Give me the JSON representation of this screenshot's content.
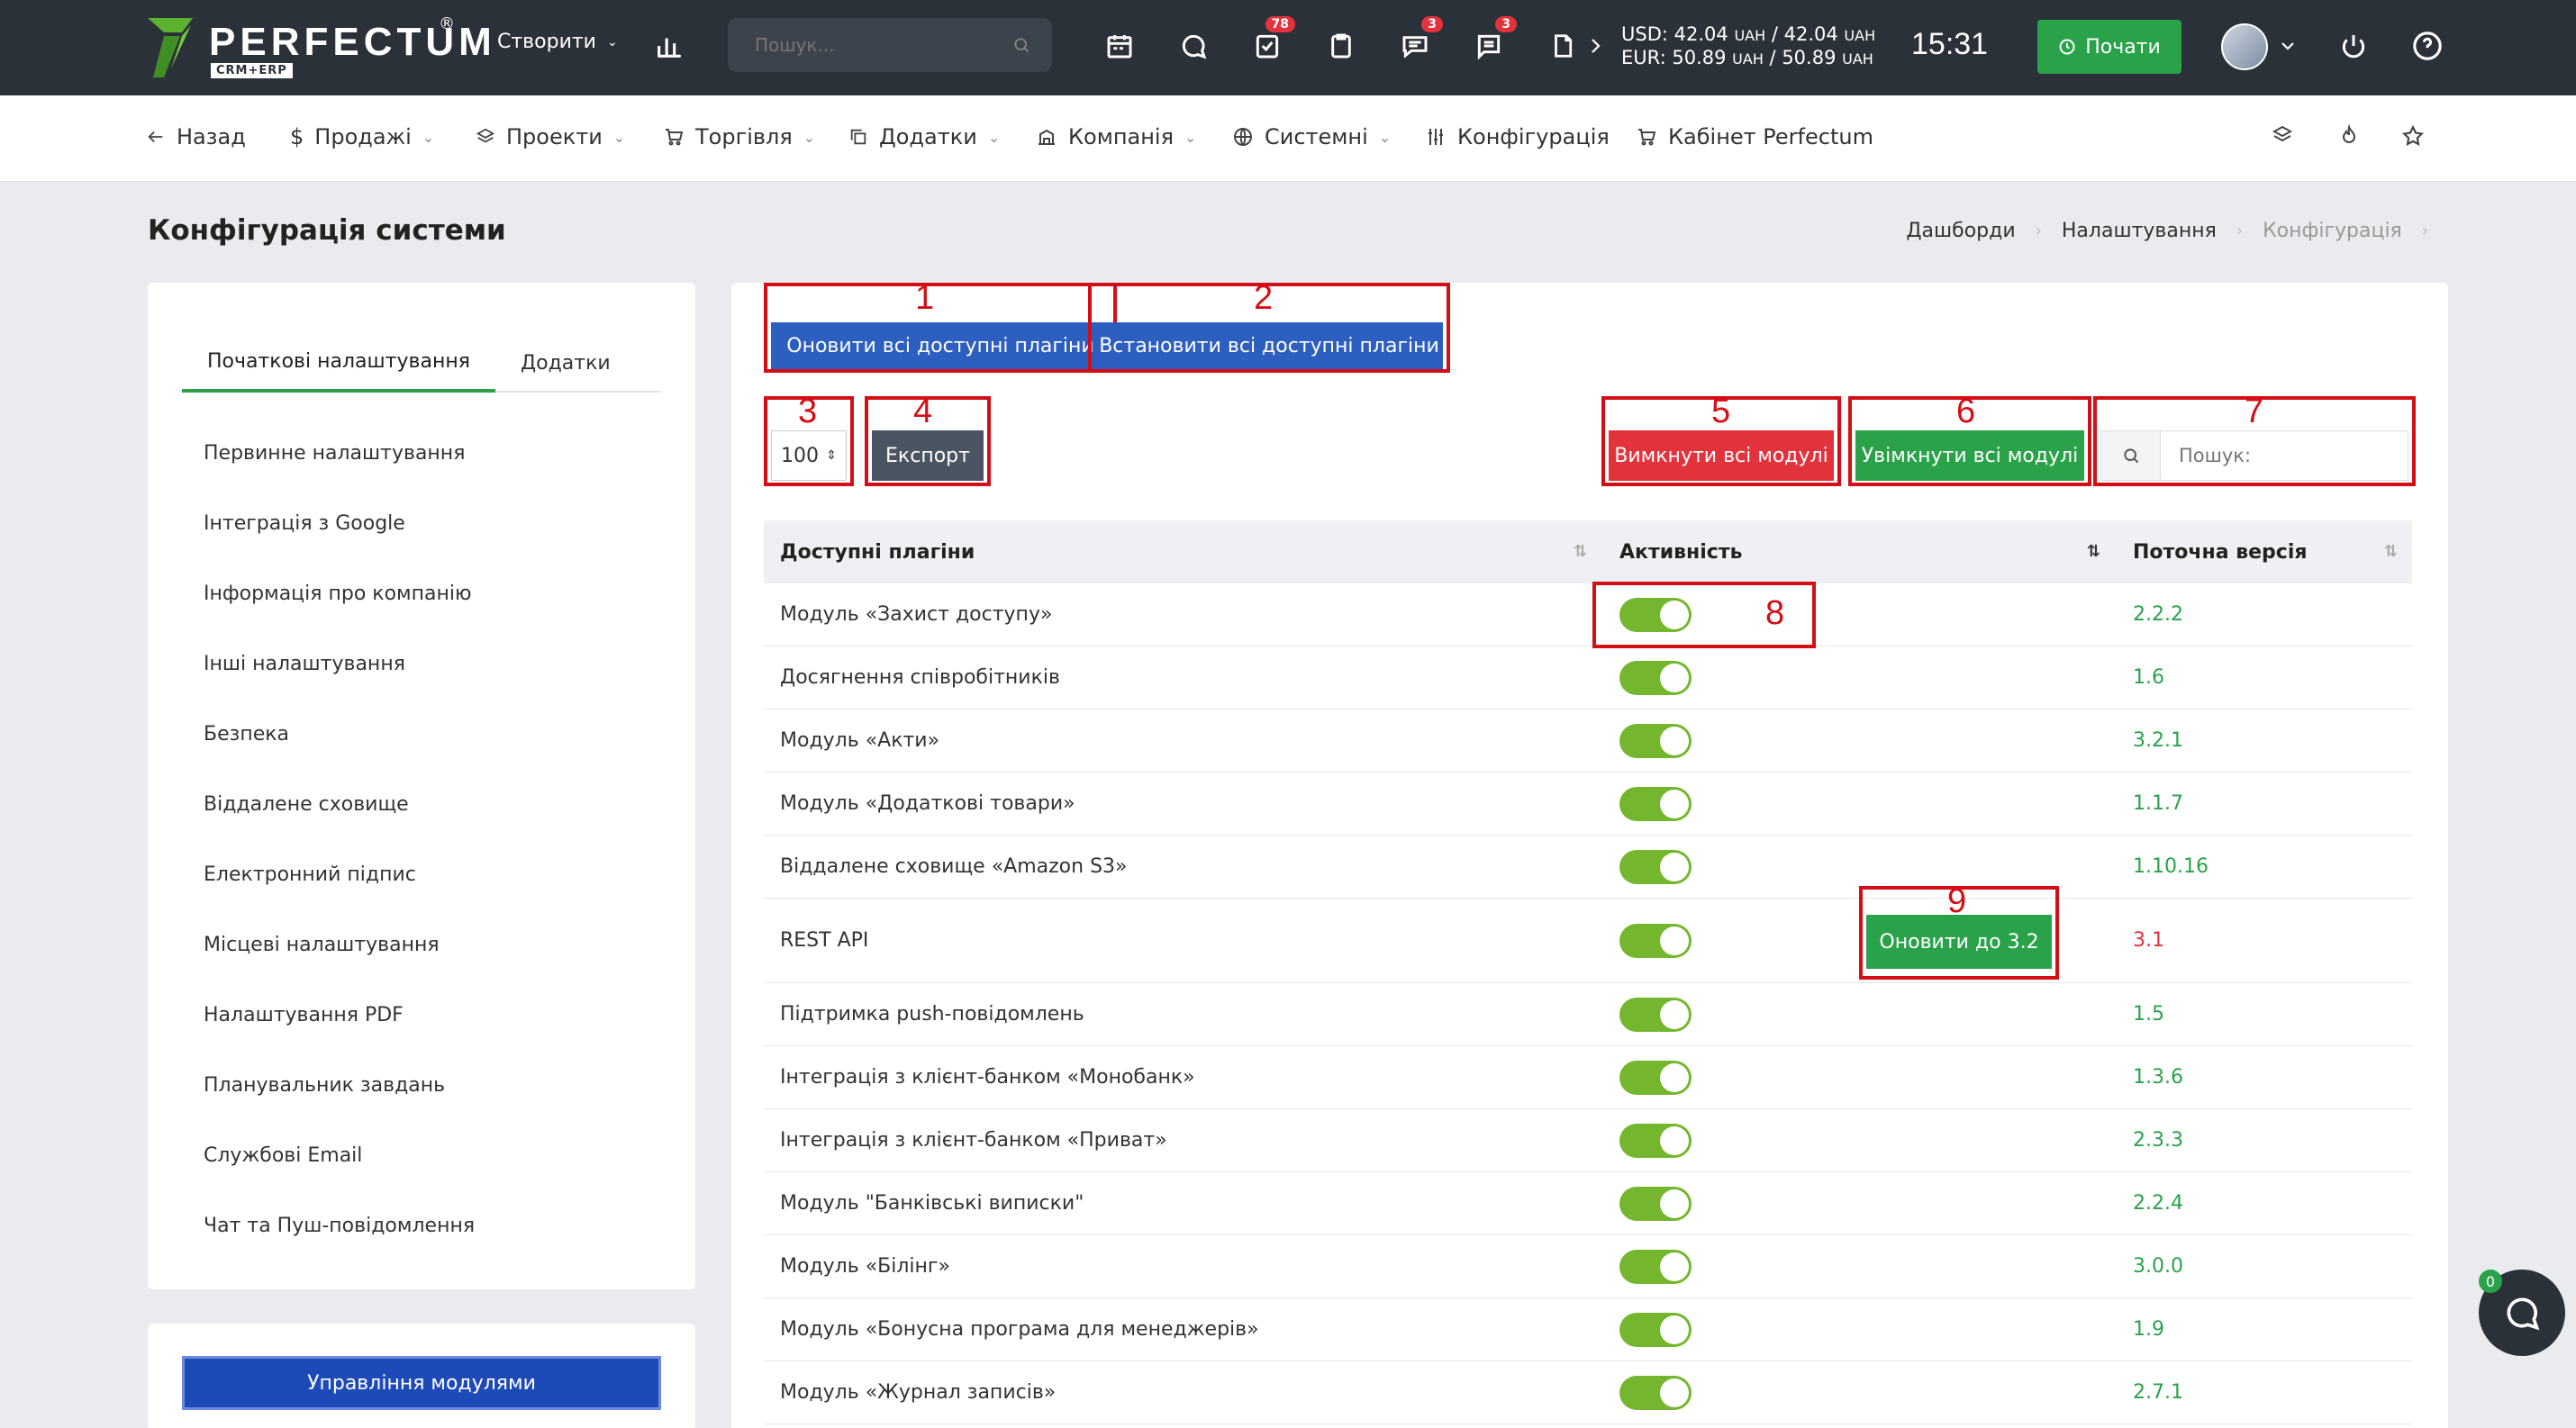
{
  "topbar": {
    "logo_text": "PERFECTUM",
    "logo_reg": "®",
    "logo_sub": "CRM+ERP",
    "create_label": "Створити",
    "search_placeholder": "Пошук...",
    "badges": {
      "tasks": "78",
      "chat": "3",
      "messages": "3"
    },
    "currency_usd_label": "USD:",
    "currency_usd": "42.04",
    "currency_usd_sep": "/",
    "currency_usd_2": "42.04",
    "currency_eur_label": "EUR:",
    "currency_eur": "50.89",
    "currency_eur_sep": "/",
    "currency_eur_2": "50.89",
    "currency_unit": "UAH",
    "clock": "15:31",
    "start_label": "Почати"
  },
  "navbar": {
    "back": "Назад",
    "sales": "Продажі",
    "projects": "Проекти",
    "trade": "Торгівля",
    "addons": "Додатки",
    "company": "Компанія",
    "system": "Системні",
    "config": "Конфігурація",
    "cabinet": "Кабінет Perfectum"
  },
  "page": {
    "title": "Конфігурація системи",
    "breadcrumb": [
      "Дашборди",
      "Налаштування",
      "Конфігурація"
    ]
  },
  "left": {
    "tabs": [
      "Початкові налаштування",
      "Додатки"
    ],
    "items": [
      "Первинне налаштування",
      "Інтеграція з Google",
      "Інформація про компанію",
      "Інші налаштування",
      "Безпека",
      "Віддалене сховище",
      "Електронний підпис",
      "Місцеві налаштування",
      "Налаштування PDF",
      "Планувальник завдань",
      "Службові Email",
      "Чат та Пуш-повідомлення"
    ],
    "modules_button": "Управління модулями"
  },
  "main": {
    "update_all": "Оновити всі доступні плагіни",
    "install_all": "Встановити всі доступні плагіни",
    "page_size": "100",
    "export": "Експорт",
    "disable_all": "Вимкнути всі модулі",
    "enable_all": "Увімкнути всі модулі",
    "search_placeholder": "Пошук:",
    "annotations": [
      "1",
      "2",
      "3",
      "4",
      "5",
      "6",
      "7",
      "8",
      "9"
    ],
    "columns": [
      "Доступні плагіни",
      "Активність",
      "Поточна версія"
    ],
    "update_to_label": "Оновити до 3.2",
    "rows": [
      {
        "name": "Модуль «Захист доступу»",
        "version": "2.2.2"
      },
      {
        "name": "Досягнення співробітників",
        "version": "1.6"
      },
      {
        "name": "Модуль «Акти»",
        "version": "3.2.1"
      },
      {
        "name": "Модуль «Додаткові товари»",
        "version": "1.1.7"
      },
      {
        "name": "Віддалене сховище «Amazon S3»",
        "version": "1.10.16"
      },
      {
        "name": "REST API",
        "version": "3.1"
      },
      {
        "name": "Підтримка push-повідомлень",
        "version": "1.5"
      },
      {
        "name": "Інтеграція з клієнт-банком «Монобанк»",
        "version": "1.3.6"
      },
      {
        "name": "Інтеграція з клієнт-банком «Приват»",
        "version": "2.3.3"
      },
      {
        "name": "Модуль \"Банківські виписки\"",
        "version": "2.2.4"
      },
      {
        "name": "Модуль «Білінг»",
        "version": "3.0.0"
      },
      {
        "name": "Модуль «Бонусна програма для менеджерів»",
        "version": "1.9"
      },
      {
        "name": "Модуль «Журнал записів»",
        "version": "2.7.1"
      }
    ]
  },
  "chat": {
    "badge": "0"
  },
  "colors": {
    "green": "#2aa24a",
    "red": "#e2323c",
    "blue": "#2d5fc0",
    "dark": "#2b3139",
    "annotation": "#d40e16"
  }
}
